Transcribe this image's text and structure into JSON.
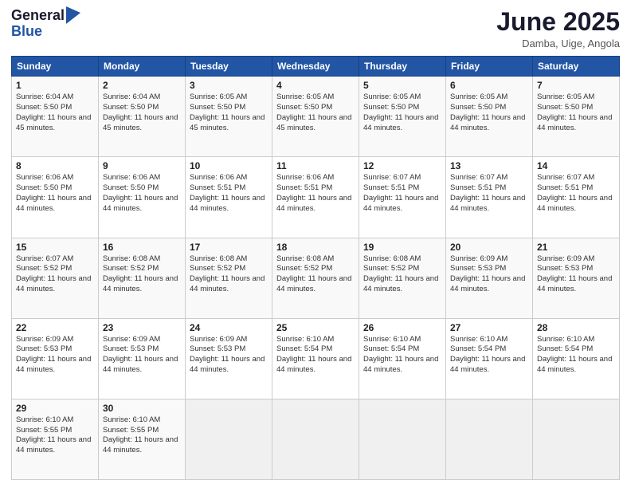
{
  "header": {
    "logo_general": "General",
    "logo_blue": "Blue",
    "month_title": "June 2025",
    "location": "Damba, Uige, Angola"
  },
  "calendar": {
    "days_of_week": [
      "Sunday",
      "Monday",
      "Tuesday",
      "Wednesday",
      "Thursday",
      "Friday",
      "Saturday"
    ],
    "weeks": [
      [
        null,
        {
          "day": 2,
          "sunrise": "6:04 AM",
          "sunset": "5:50 PM",
          "daylight": "11 hours and 45 minutes."
        },
        {
          "day": 3,
          "sunrise": "6:05 AM",
          "sunset": "5:50 PM",
          "daylight": "11 hours and 45 minutes."
        },
        {
          "day": 4,
          "sunrise": "6:05 AM",
          "sunset": "5:50 PM",
          "daylight": "11 hours and 45 minutes."
        },
        {
          "day": 5,
          "sunrise": "6:05 AM",
          "sunset": "5:50 PM",
          "daylight": "11 hours and 44 minutes."
        },
        {
          "day": 6,
          "sunrise": "6:05 AM",
          "sunset": "5:50 PM",
          "daylight": "11 hours and 44 minutes."
        },
        {
          "day": 7,
          "sunrise": "6:05 AM",
          "sunset": "5:50 PM",
          "daylight": "11 hours and 44 minutes."
        }
      ],
      [
        {
          "day": 1,
          "sunrise": "6:04 AM",
          "sunset": "5:50 PM",
          "daylight": "11 hours and 45 minutes."
        },
        {
          "day": 8,
          "sunrise": "6:06 AM",
          "sunset": "5:50 PM",
          "daylight": "11 hours and 44 minutes."
        },
        {
          "day": 9,
          "sunrise": "6:06 AM",
          "sunset": "5:50 PM",
          "daylight": "11 hours and 44 minutes."
        },
        {
          "day": 10,
          "sunrise": "6:06 AM",
          "sunset": "5:51 PM",
          "daylight": "11 hours and 44 minutes."
        },
        {
          "day": 11,
          "sunrise": "6:06 AM",
          "sunset": "5:51 PM",
          "daylight": "11 hours and 44 minutes."
        },
        {
          "day": 12,
          "sunrise": "6:07 AM",
          "sunset": "5:51 PM",
          "daylight": "11 hours and 44 minutes."
        },
        {
          "day": 13,
          "sunrise": "6:07 AM",
          "sunset": "5:51 PM",
          "daylight": "11 hours and 44 minutes."
        }
      ],
      [
        {
          "day": 14,
          "sunrise": "6:07 AM",
          "sunset": "5:51 PM",
          "daylight": "11 hours and 44 minutes."
        },
        {
          "day": 15,
          "sunrise": "6:07 AM",
          "sunset": "5:52 PM",
          "daylight": "11 hours and 44 minutes."
        },
        {
          "day": 16,
          "sunrise": "6:08 AM",
          "sunset": "5:52 PM",
          "daylight": "11 hours and 44 minutes."
        },
        {
          "day": 17,
          "sunrise": "6:08 AM",
          "sunset": "5:52 PM",
          "daylight": "11 hours and 44 minutes."
        },
        {
          "day": 18,
          "sunrise": "6:08 AM",
          "sunset": "5:52 PM",
          "daylight": "11 hours and 44 minutes."
        },
        {
          "day": 19,
          "sunrise": "6:08 AM",
          "sunset": "5:52 PM",
          "daylight": "11 hours and 44 minutes."
        },
        {
          "day": 20,
          "sunrise": "6:09 AM",
          "sunset": "5:53 PM",
          "daylight": "11 hours and 44 minutes."
        }
      ],
      [
        {
          "day": 21,
          "sunrise": "6:09 AM",
          "sunset": "5:53 PM",
          "daylight": "11 hours and 44 minutes."
        },
        {
          "day": 22,
          "sunrise": "6:09 AM",
          "sunset": "5:53 PM",
          "daylight": "11 hours and 44 minutes."
        },
        {
          "day": 23,
          "sunrise": "6:09 AM",
          "sunset": "5:53 PM",
          "daylight": "11 hours and 44 minutes."
        },
        {
          "day": 24,
          "sunrise": "6:09 AM",
          "sunset": "5:53 PM",
          "daylight": "11 hours and 44 minutes."
        },
        {
          "day": 25,
          "sunrise": "6:10 AM",
          "sunset": "5:54 PM",
          "daylight": "11 hours and 44 minutes."
        },
        {
          "day": 26,
          "sunrise": "6:10 AM",
          "sunset": "5:54 PM",
          "daylight": "11 hours and 44 minutes."
        },
        {
          "day": 27,
          "sunrise": "6:10 AM",
          "sunset": "5:54 PM",
          "daylight": "11 hours and 44 minutes."
        }
      ],
      [
        {
          "day": 28,
          "sunrise": "6:10 AM",
          "sunset": "5:54 PM",
          "daylight": "11 hours and 44 minutes."
        },
        {
          "day": 29,
          "sunrise": "6:10 AM",
          "sunset": "5:55 PM",
          "daylight": "11 hours and 44 minutes."
        },
        {
          "day": 30,
          "sunrise": "6:10 AM",
          "sunset": "5:55 PM",
          "daylight": "11 hours and 44 minutes."
        },
        null,
        null,
        null,
        null
      ]
    ]
  }
}
